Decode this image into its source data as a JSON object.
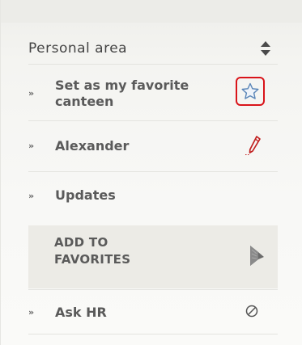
{
  "header": {
    "title": "Personal area"
  },
  "menu": {
    "chevron": "»",
    "items": [
      {
        "label": "Set as my favorite canteen",
        "icon": "star-icon"
      },
      {
        "label": "Alexander",
        "icon": "pencil-icon"
      },
      {
        "label": "Updates"
      },
      {
        "label": "ADD TO\nFAVORITES",
        "icon": "bookmark-arrow-icon"
      },
      {
        "label": "Ask HR",
        "icon": "block-icon"
      }
    ]
  },
  "colors": {
    "highlight": "#d9141a",
    "star": "#5b86b8",
    "pencil": "#c11f1f",
    "text": "#5a5a5a",
    "fav_background": "#ecebe6"
  }
}
